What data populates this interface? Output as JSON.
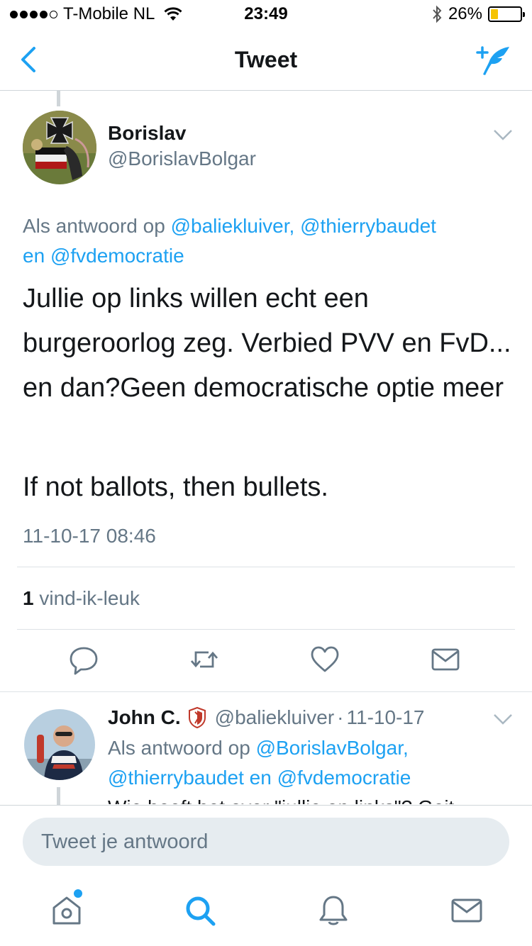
{
  "status_bar": {
    "carrier": "T-Mobile NL",
    "time": "23:49",
    "battery": "26%",
    "battery_level": 0.26
  },
  "nav": {
    "title": "Tweet"
  },
  "tweet": {
    "author_name": "Borislav",
    "author_handle": "@BorislavBolgar",
    "reply_prefix": "Als antwoord op",
    "reply_mentions": "@baliekluiver, @thierrybaudet",
    "reply_and": "en",
    "reply_last": "@fvdemocratie",
    "text_paragraph_1": "Jullie op links willen echt een burgeroorlog zeg. Verbied PVV en FvD... en dan?Geen democratische optie meer",
    "text_paragraph_2": "If not ballots, then bullets.",
    "timestamp": "11-10-17 08:46",
    "likes_count": "1",
    "likes_label": "vind-ik-leuk"
  },
  "reply": {
    "author_name": "John C.",
    "author_handle": "@baliekluiver",
    "separator": "·",
    "date": "11-10-17",
    "reply_prefix": "Als antwoord op",
    "mention_1": "@BorislavBolgar,",
    "mention_2": "@thierrybaudet",
    "reply_and": "en",
    "mention_3": "@fvdemocratie",
    "text_clipped": "Wie heeft het over \"jullie op links\"? Geit"
  },
  "compose": {
    "placeholder": "Tweet je antwoord"
  },
  "icons": {
    "back": "chevron-left-icon",
    "compose": "compose-tweet-icon",
    "reply": "reply-icon",
    "retweet": "retweet-icon",
    "like": "heart-icon",
    "dm": "envelope-icon",
    "home": "home-icon",
    "search": "search-icon",
    "notifications": "bell-icon",
    "messages": "envelope-icon"
  },
  "colors": {
    "accent": "#1da1f2",
    "secondary_text": "#657786",
    "battery": "#f5c400"
  }
}
